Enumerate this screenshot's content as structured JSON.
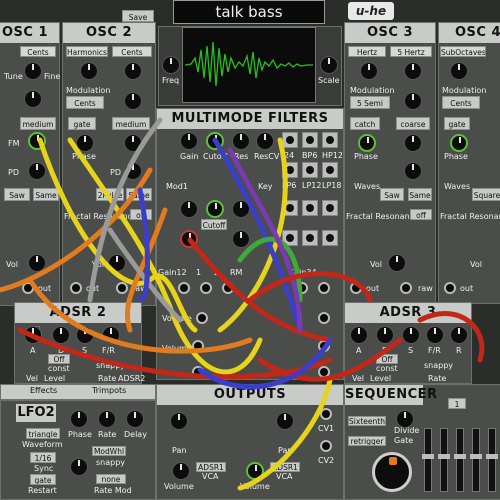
{
  "header": {
    "save_label": "Save",
    "preset_name": "talk bass",
    "logo": "u-he"
  },
  "osc1": {
    "title": "OSC 1",
    "mode": "Cents",
    "labels": [
      "Tune",
      "Fine",
      "FM",
      "PD",
      "Vol"
    ],
    "buttons": [
      "medium",
      "Saw",
      "Same",
      "out"
    ]
  },
  "osc2": {
    "title": "OSC 2",
    "selects": [
      "Harmonics",
      "Cents"
    ],
    "labels": [
      "Modulation",
      "Phase",
      "PD",
      "Fractal Resonance",
      "Vol"
    ],
    "buttons": [
      "gate",
      "medium",
      "Cents",
      "2Pulse",
      "Same",
      "off",
      "out",
      "raw"
    ]
  },
  "scope": {
    "freq_label": "Freq",
    "scale_label": "Scale"
  },
  "filters": {
    "title": "MULTIMODE FILTERS",
    "row_labels": [
      "Gain",
      "Cutoff",
      "Res",
      "ResCV",
      "Key"
    ],
    "modes": [
      "24",
      "BP6",
      "HP12",
      "LP6",
      "LP12",
      "LP18"
    ],
    "bottom_labels": [
      "Gain12",
      "1",
      "2",
      "RM",
      "Gain34",
      "Mod1"
    ],
    "cutoff_button": "Cutoff"
  },
  "osc3": {
    "title": "OSC 3",
    "selects": [
      "Hertz",
      "5 Hertz"
    ],
    "labels": [
      "Tune",
      "Fine",
      "Modulation",
      "Phase",
      "Waves",
      "Fractal Resonance",
      "Vol"
    ],
    "buttons": [
      "5 Semi",
      "catch",
      "coarse",
      "Saw",
      "Same",
      "off",
      "out",
      "raw"
    ]
  },
  "osc4": {
    "title": "OSC 4",
    "selects": [
      "SubOctaves"
    ],
    "labels": [
      "Tune",
      "Modulation",
      "Phase",
      "Waves",
      "Fractal Resonance",
      "Vol"
    ],
    "buttons": [
      "Cents",
      "gate",
      "Square",
      "off",
      "out"
    ]
  },
  "adsr2": {
    "title": "ADSR 2",
    "labels": [
      "A",
      "D",
      "S",
      "F/R",
      "Vel",
      "Level",
      "const",
      "Rate",
      "ADSR2"
    ],
    "buttons": [
      "Off",
      "const",
      "snappy"
    ]
  },
  "adsr3": {
    "title": "ADSR 3",
    "labels": [
      "A",
      "D",
      "S",
      "F/R",
      "R",
      "Vel",
      "Level",
      "Rate"
    ],
    "buttons": [
      "Off",
      "const",
      "snappy"
    ]
  },
  "bottom_tabs": {
    "effects": "Effects",
    "trimpots": "Trimpots"
  },
  "lfo2": {
    "title": "LFO2",
    "labels": [
      "Phase",
      "Rate",
      "Delay",
      "Waveform",
      "Sync",
      "Restart",
      "Rate Mod"
    ],
    "buttons": [
      "triangle",
      "1/16",
      "gate",
      "ModWhl",
      "snappy",
      "none"
    ]
  },
  "outputs": {
    "title": "OUTPUTS",
    "labels": [
      "Pan",
      "Pan",
      "Volume",
      "Volume",
      "CV1",
      "CV2",
      "VCA",
      "VCA"
    ],
    "buttons": [
      "ADSR1",
      "ADSR1"
    ]
  },
  "sequencer": {
    "title": "SEQUENCER",
    "buttons": [
      "Sixteenth",
      "retrigger",
      "1"
    ],
    "labels": [
      "Divide",
      "Gate"
    ]
  },
  "colors": {
    "panel": "#4a4d4a",
    "title_bar": "#c9cbc9",
    "scope_green": "#26c21a",
    "accent_green": "#5fbf3a",
    "accent_red": "#c73a2c",
    "accent_orange": "#e07b20"
  }
}
